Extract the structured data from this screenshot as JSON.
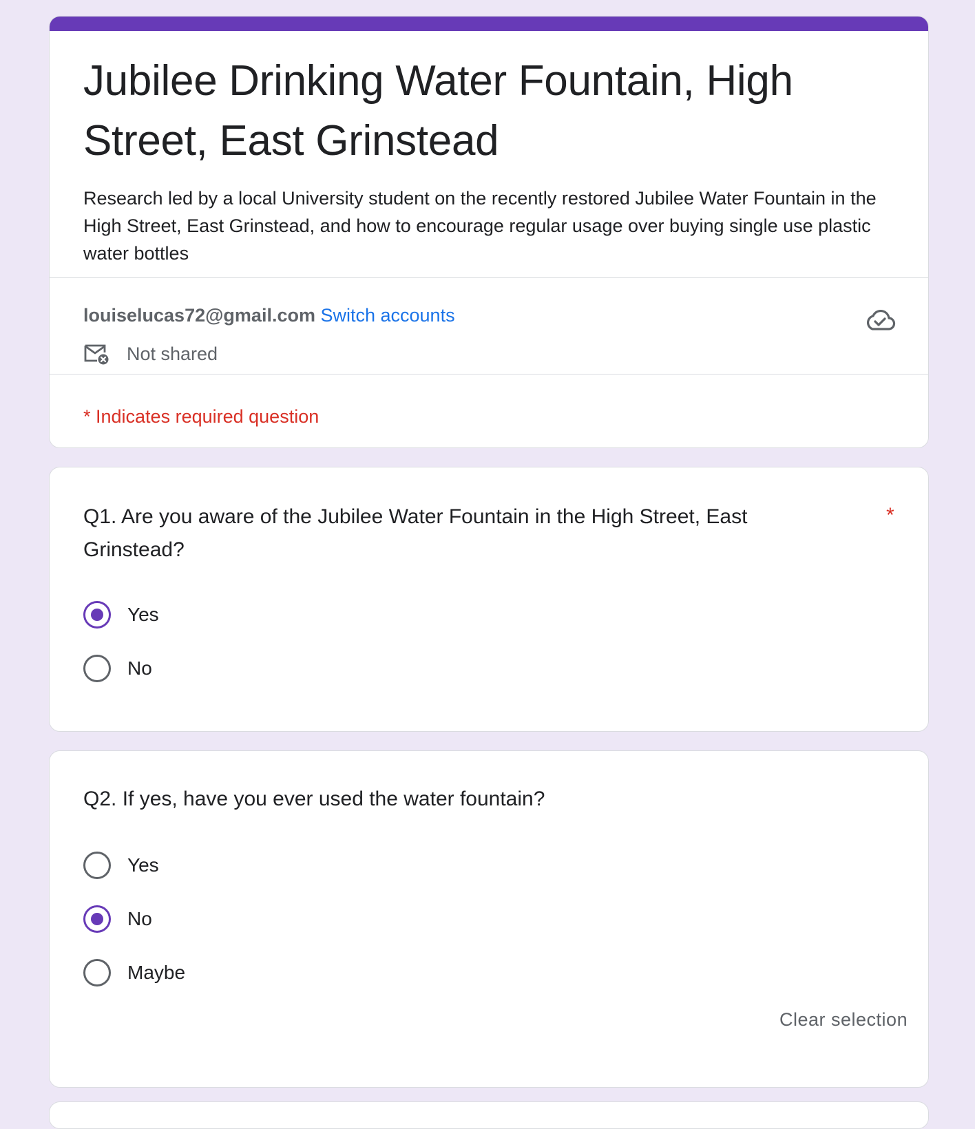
{
  "colors": {
    "accent": "#673ab7",
    "background": "#ede7f6",
    "required": "#d93025",
    "link": "#1a73e8"
  },
  "form": {
    "title": "Jubilee Drinking Water Fountain, High Street, East Grinstead",
    "description": "Research led by a local University student on the recently restored Jubilee Water Fountain in the High Street, East Grinstead,  and how to encourage regular usage over buying single use plastic water bottles"
  },
  "account": {
    "email": "louiselucas72@gmail.com",
    "switch_label": "Switch accounts",
    "sharing_status": "Not shared",
    "sharing_icon": "mail-not-shared-icon",
    "save_status_icon": "cloud-saved-icon"
  },
  "required_note": "* Indicates required question",
  "questions": [
    {
      "title": "Q1. Are you aware of the Jubilee Water Fountain in the High Street, East Grinstead?",
      "required_marker": "*",
      "options": [
        {
          "label": "Yes",
          "selected": true
        },
        {
          "label": "No",
          "selected": false
        }
      ]
    },
    {
      "title": "Q2. If yes, have you ever used the water fountain?",
      "options": [
        {
          "label": "Yes",
          "selected": false
        },
        {
          "label": "No",
          "selected": true
        },
        {
          "label": "Maybe",
          "selected": false
        }
      ],
      "clear_label": "Clear selection"
    }
  ]
}
